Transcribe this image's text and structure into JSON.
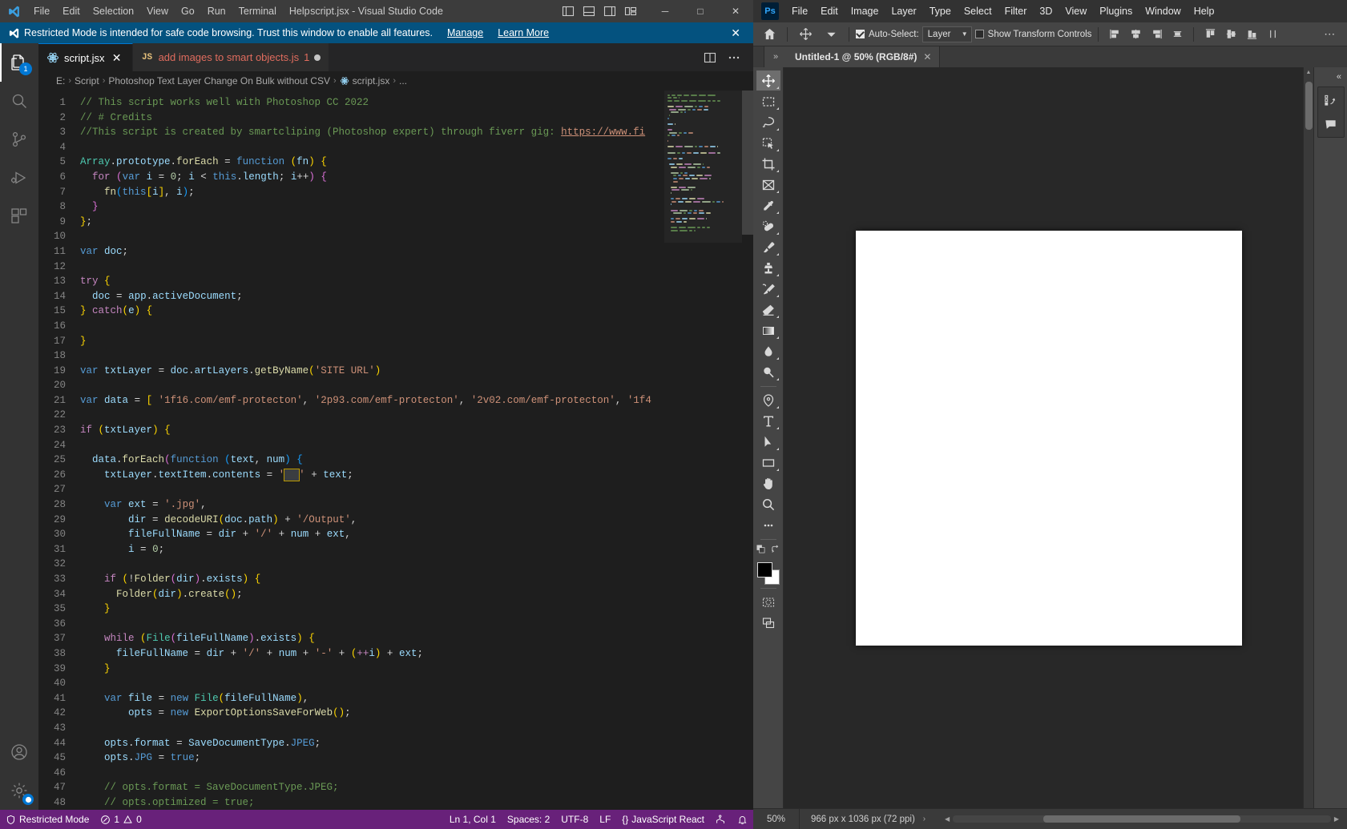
{
  "vscode": {
    "window_title": "script.jsx - Visual Studio Code",
    "menu": [
      "File",
      "Edit",
      "Selection",
      "View",
      "Go",
      "Run",
      "Terminal",
      "Help"
    ],
    "layout_icons": [
      "layout-sidebar-left-icon",
      "layout-panel-icon",
      "layout-sidebar-right-icon",
      "layout-grid-icon"
    ],
    "window_controls": {
      "minimize": "─",
      "maximize": "□",
      "close": "✕"
    },
    "banner": {
      "text": "Restricted Mode is intended for safe code browsing. Trust this window to enable all features.",
      "manage_link": "Manage",
      "learn_more_link": "Learn More",
      "close": "✕"
    },
    "activity_items": [
      {
        "name": "explorer",
        "badge": "1"
      },
      {
        "name": "search",
        "badge": ""
      },
      {
        "name": "source-control",
        "badge": ""
      },
      {
        "name": "run-and-debug",
        "badge": ""
      },
      {
        "name": "extensions",
        "badge": ""
      }
    ],
    "tabs": [
      {
        "label": "script.jsx",
        "icon": "jsx-file-icon",
        "active": true,
        "modified": false,
        "badge": ""
      },
      {
        "label": "add images to smart objects.js",
        "icon": "js-file-icon",
        "active": false,
        "modified": true,
        "badge": "1"
      }
    ],
    "tab_actions": [
      "split-editor-icon",
      "more-actions-icon"
    ],
    "breadcrumb": [
      "E:",
      "Script",
      "Photoshop Text Layer Change On Bulk without CSV",
      "script.jsx",
      "..."
    ],
    "code_lines": [
      "// This script works well with Photoshop CC 2022",
      "// # Credits",
      "//This script is created by smartcliping (Photoshop expert) through fiverr gig: https://www.fi",
      "",
      "Array.prototype.forEach = function (fn) {",
      "  for (var i = 0; i < this.length; i++) {",
      "    fn(this[i], i);",
      "  }",
      "};",
      "",
      "var doc;",
      "",
      "try {",
      "  doc = app.activeDocument;",
      "} catch(e) {",
      "",
      "}",
      "",
      "var txtLayer = doc.artLayers.getByName('SITE URL')",
      "",
      "var data = [ '1f16.com/emf-protecton', '2p93.com/emf-protecton', '2v02.com/emf-protecton', '1f4",
      "",
      "if (txtLayer) {",
      "",
      "  data.forEach(function (text, num) {",
      "    txtLayer.textItem.contents = '' + text;",
      "",
      "    var ext = '.jpg',",
      "        dir = decodeURI(doc.path) + '/Output',",
      "        fileFullName = dir + '/' + num + ext,",
      "        i = 0;",
      "",
      "    if (!Folder(dir).exists) {",
      "      Folder(dir).create();",
      "    }",
      "",
      "    while (File(fileFullName).exists) {",
      "      fileFullName = dir + '/' + num + '-' + (++i) + ext;",
      "    }",
      "",
      "    var file = new File(fileFullName),",
      "        opts = new ExportOptionsSaveForWeb();",
      "",
      "    opts.format = SaveDocumentType.JPEG;",
      "    opts.JPG = true;",
      "",
      "    // opts.format = SaveDocumentType.JPEG;",
      "    // opts.optimized = true;"
    ],
    "first_line_number": 1,
    "statusbar": {
      "restricted_mode": "Restricted Mode",
      "errors": "1",
      "warnings": "0",
      "cursor": "Ln 1, Col 1",
      "spaces": "Spaces: 2",
      "encoding": "UTF-8",
      "eol": "LF",
      "language": "JavaScript React",
      "icons": [
        "remote-icon",
        "bell-icon"
      ]
    }
  },
  "photoshop": {
    "menu": [
      "File",
      "Edit",
      "Image",
      "Layer",
      "Type",
      "Select",
      "Filter",
      "3D",
      "View",
      "Plugins",
      "Window",
      "Help"
    ],
    "logo": "Ps",
    "options_bar": {
      "home_icon": "home-icon",
      "move_tool_icon": "move-tool-icon",
      "auto_select_label": "Auto-Select:",
      "auto_select_checked": true,
      "auto_select_target": "Layer",
      "show_transform_label": "Show Transform Controls",
      "show_transform_checked": false,
      "align_icons": [
        "align-left-edges-icon",
        "align-horizontal-centers-icon",
        "align-right-edges-icon",
        "distribute-horizontally-icon",
        "align-top-edges-icon",
        "align-vertical-centers-icon",
        "align-bottom-edges-icon",
        "distribute-vertically-icon"
      ],
      "more_icon": "more-options-icon"
    },
    "document_tab": {
      "title": "Untitled-1 @ 50% (RGB/8#)",
      "close": "✕",
      "dock_toggle": "»"
    },
    "tools": [
      "move-tool-icon",
      "rectangular-marquee-tool-icon",
      "lasso-tool-icon",
      "object-selection-tool-icon",
      "crop-tool-icon",
      "frame-tool-icon",
      "eyedropper-tool-icon",
      "spot-healing-brush-tool-icon",
      "brush-tool-icon",
      "clone-stamp-tool-icon",
      "history-brush-tool-icon",
      "eraser-tool-icon",
      "gradient-tool-icon",
      "blur-tool-icon",
      "dodge-tool-icon",
      "pen-tool-icon",
      "type-tool-icon",
      "path-selection-tool-icon",
      "rectangle-tool-icon",
      "hand-tool-icon",
      "zoom-tool-icon",
      "edit-toolbar-icon"
    ],
    "color_swatches": {
      "foreground": "#000000",
      "background": "#ffffff",
      "default_colors_icon": "default-colors-icon",
      "swap_colors_icon": "swap-colors-icon"
    },
    "bottom_tools": [
      "quick-mask-icon",
      "screen-mode-icon"
    ],
    "right_dock": {
      "collapse_icon": "«",
      "panels": [
        "actions-panel-icon",
        "comments-panel-icon"
      ]
    },
    "statusbar": {
      "zoom": "50%",
      "doc_info": "966 px x 1036 px (72 ppi)",
      "expand_arrow": "›"
    }
  },
  "colors": {
    "vs_accent": "#0078d4",
    "vs_status": "#68217a",
    "vs_banner": "#04527f",
    "vs_editor_bg": "#1e1e1e",
    "ps_panel": "#454545",
    "ps_canvas_bg": "#282828",
    "ps_chrome": "#323232",
    "modified_tab": "#e06c5e"
  }
}
